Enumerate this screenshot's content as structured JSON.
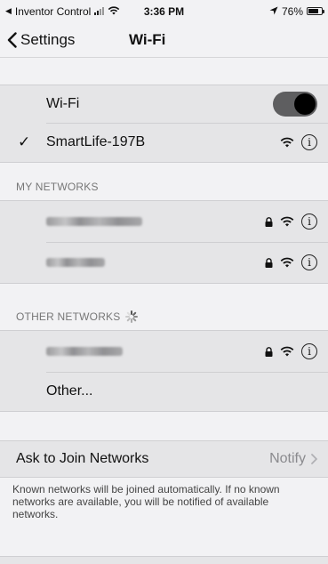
{
  "status_bar": {
    "back_app": "Inventor Control",
    "time": "3:36 PM",
    "battery_text": "76%",
    "battery_level": 0.76
  },
  "nav": {
    "back_label": "Settings",
    "title": "Wi-Fi"
  },
  "wifi": {
    "label": "Wi-Fi",
    "enabled": true,
    "connected_network": "SmartLife-197B"
  },
  "my_networks": {
    "header": "MY NETWORKS",
    "items": [
      {
        "name": "",
        "secured": true
      },
      {
        "name": "",
        "secured": true
      }
    ]
  },
  "other_networks": {
    "header": "OTHER NETWORKS",
    "items": [
      {
        "name": "",
        "secured": true
      }
    ],
    "other_label": "Other..."
  },
  "ask_join": {
    "label": "Ask to Join Networks",
    "value": "Notify",
    "note": "Known networks will be joined automatically. If no known networks are available, you will be notified of available networks."
  },
  "icons": {
    "info": "info-icon",
    "lock": "lock-icon",
    "wifi": "wifi-icon"
  }
}
